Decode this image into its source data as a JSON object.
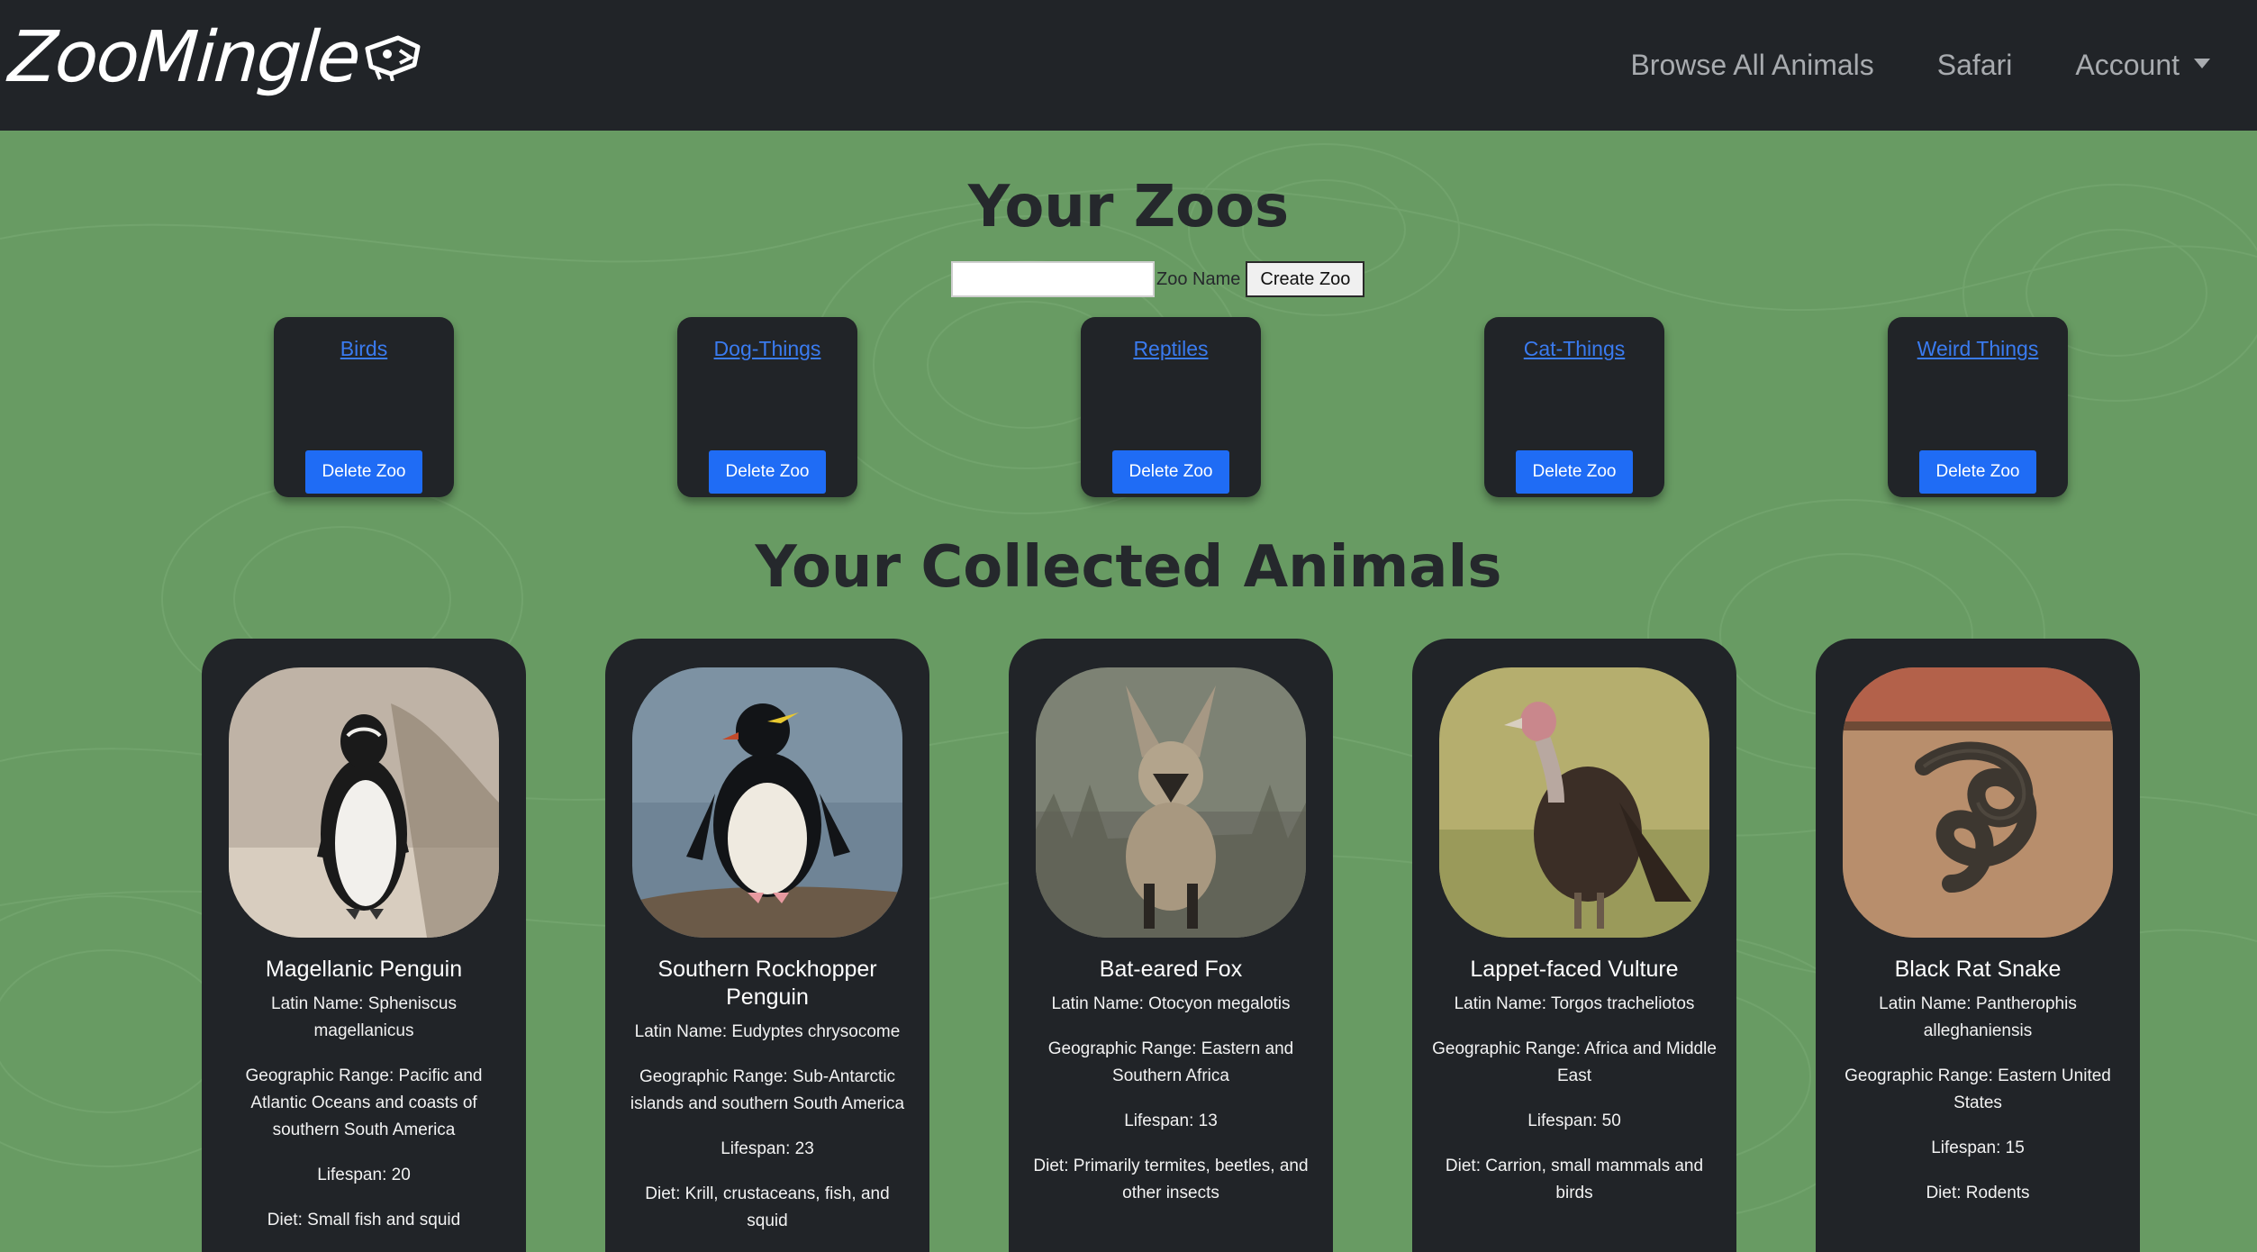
{
  "nav": {
    "logo": "ZooMingle",
    "links": [
      "Browse All Animals",
      "Safari",
      "Account"
    ]
  },
  "zoos": {
    "title": "Your Zoos",
    "input_label": "Zoo Name",
    "create_label": "Create Zoo",
    "items": [
      {
        "name": "Birds",
        "delete_label": "Delete Zoo"
      },
      {
        "name": "Dog-Things",
        "delete_label": "Delete Zoo"
      },
      {
        "name": "Reptiles",
        "delete_label": "Delete Zoo"
      },
      {
        "name": "Cat-Things",
        "delete_label": "Delete Zoo"
      },
      {
        "name": "Weird Things",
        "delete_label": "Delete Zoo"
      }
    ]
  },
  "animals": {
    "title": "Your Collected Animals",
    "items": [
      {
        "name": "Magellanic Penguin",
        "latin": "Latin Name: Spheniscus magellanicus",
        "range": "Geographic Range: Pacific and Atlantic Oceans and coasts of southern South America",
        "lifespan": "Lifespan: 20",
        "diet": "Diet: Small fish and squid"
      },
      {
        "name": "Southern Rockhopper Penguin",
        "latin": "Latin Name: Eudyptes chrysocome",
        "range": "Geographic Range: Sub-Antarctic islands and southern South America",
        "lifespan": "Lifespan: 23",
        "diet": "Diet: Krill, crustaceans, fish, and squid"
      },
      {
        "name": "Bat-eared Fox",
        "latin": "Latin Name: Otocyon megalotis",
        "range": "Geographic Range: Eastern and Southern Africa",
        "lifespan": "Lifespan: 13",
        "diet": "Diet: Primarily termites, beetles, and other insects"
      },
      {
        "name": "Lappet-faced Vulture",
        "latin": "Latin Name: Torgos tracheliotos",
        "range": "Geographic Range: Africa and Middle East",
        "lifespan": "Lifespan: 50",
        "diet": "Diet: Carrion, small mammals and birds"
      },
      {
        "name": "Black Rat Snake",
        "latin": "Latin Name: Pantherophis alleghaniensis",
        "range": "Geographic Range: Eastern United States",
        "lifespan": "Lifespan: 15",
        "diet": "Diet: Rodents"
      }
    ]
  },
  "colors": {
    "background": "#689b63",
    "navbar": "#212428",
    "card": "#212428",
    "button": "#1f6cf5",
    "link": "#3a7bf0"
  }
}
